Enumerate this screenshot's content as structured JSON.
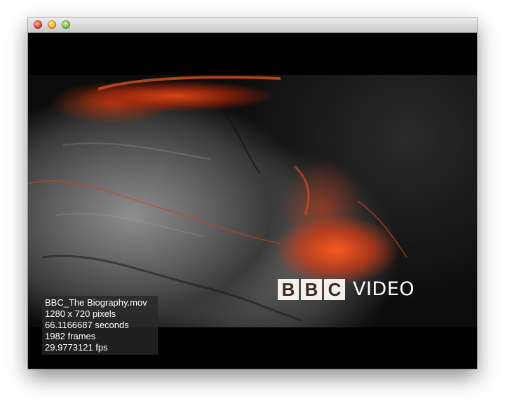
{
  "window": {
    "title": ""
  },
  "video": {
    "watermark": {
      "letters": [
        "B",
        "B",
        "C"
      ],
      "word": "VIDEO"
    }
  },
  "info": {
    "filename": "BBC_The Biography.mov",
    "resolution": "1280 x 720 pixels",
    "duration": "66.1166687 seconds",
    "frames": "1982 frames",
    "fps": "29.9773121 fps"
  },
  "colors": {
    "close": "#e4463a",
    "minimize": "#f0b02d",
    "zoom": "#7dc243",
    "lava": "#ff5a1e"
  },
  "icons": {
    "close": "close-icon",
    "minimize": "minimize-icon",
    "zoom": "zoom-icon"
  }
}
